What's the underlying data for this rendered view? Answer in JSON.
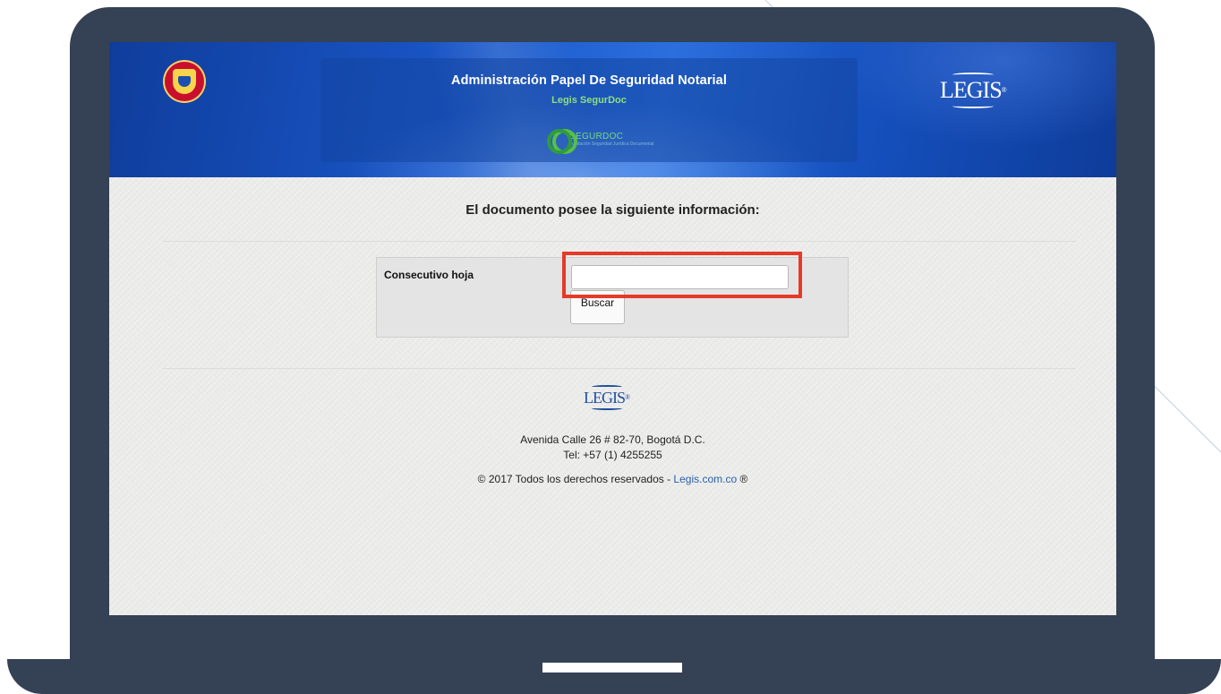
{
  "header": {
    "title": "Administración Papel De Seguridad Notarial",
    "subtitle": "Legis SegurDoc",
    "segurdoc_name": "SEGURDOC",
    "segurdoc_tagline": "Fundación Seguridad Jurídica Documental",
    "brand_logo": "LEGIS",
    "seal": "coat-of-arms"
  },
  "main": {
    "heading": "El documento posee la siguiente información:",
    "field_label": "Consecutivo hoja",
    "field_value": "",
    "button_label": "Buscar"
  },
  "footer": {
    "logo": "LEGIS",
    "address": "Avenida Calle 26 # 82-70, Bogotá D.C.",
    "phone": "Tel: +57 (1) 4255255",
    "copyright": "© 2017 Todos los derechos reservados - ",
    "link_text": "Legis.com.co",
    "registered": " ®"
  },
  "colors": {
    "device": "#354154",
    "banner": "#1a57c8",
    "highlight": "#e53a2a",
    "link": "#2b5fa8"
  }
}
